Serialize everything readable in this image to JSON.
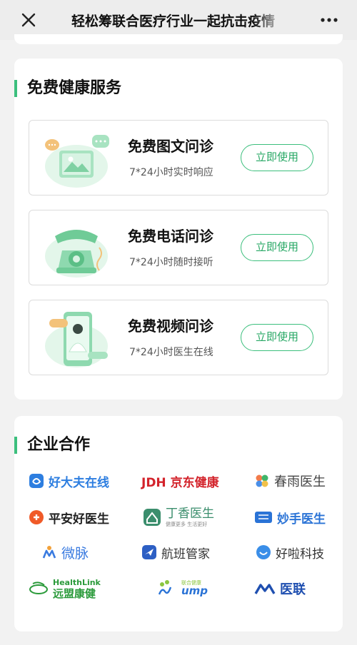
{
  "header": {
    "title": "轻松筹联合医疗行业一起抗击疫情"
  },
  "services": {
    "heading": "免费健康服务",
    "items": [
      {
        "name": "免费图文问诊",
        "desc": "7*24小时实时响应",
        "action": "立即使用"
      },
      {
        "name": "免费电话问诊",
        "desc": "7*24小时随时接听",
        "action": "立即使用"
      },
      {
        "name": "免费视频问诊",
        "desc": "7*24小时医生在线",
        "action": "立即使用"
      }
    ]
  },
  "partners": {
    "heading": "企业合作",
    "items": [
      {
        "label": "好大夫在线",
        "color": "#2d7ee0",
        "icon": "haodf-logo-icon"
      },
      {
        "label": "JDH 京东健康",
        "color": "#d3232b",
        "icon": "jdh-logo-icon"
      },
      {
        "label": "春雨医生",
        "color": "#444444",
        "icon": "chunyu-logo-icon"
      },
      {
        "label": "平安好医生",
        "color": "#222222",
        "icon": "pingan-logo-icon"
      },
      {
        "label": "丁香医生",
        "sub": "健康更多 生活更好",
        "color": "#3b8e6d",
        "icon": "dxy-logo-icon"
      },
      {
        "label": "妙手医生",
        "color": "#2a73d6",
        "icon": "miaoshou-logo-icon"
      },
      {
        "label": "微脉",
        "color": "#3a7be0",
        "icon": "weimai-logo-icon"
      },
      {
        "label": "航班管家",
        "color": "#333333",
        "icon": "hangban-logo-icon"
      },
      {
        "label": "好啦科技",
        "color": "#333333",
        "icon": "haola-logo-icon"
      },
      {
        "label": "远盟康健",
        "en": "HealthLink",
        "color": "#2a9a3a",
        "icon": "healthlink-logo-icon"
      },
      {
        "label": "ump",
        "sub": "联合健康",
        "color": "#2a73d6",
        "icon": "ump-logo-icon"
      },
      {
        "label": "医联",
        "color": "#1f4fb0",
        "icon": "yilian-logo-icon"
      }
    ]
  },
  "colors": {
    "accent": "#3cbf7d",
    "button_text": "#28a865"
  }
}
